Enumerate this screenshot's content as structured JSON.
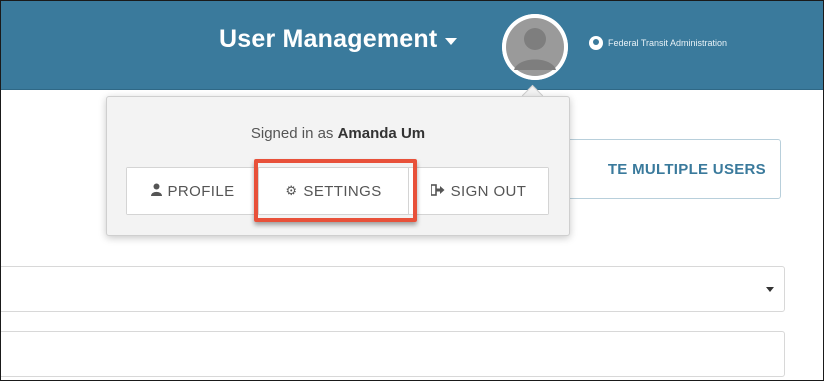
{
  "header": {
    "menu_title": "User Management",
    "agency_name": "Federal Transit Administration",
    "bar_color": "#3a7a9c",
    "avatar_icon": "user-avatar-icon"
  },
  "page": {
    "multi_users_button": "TE MULTIPLE USERS"
  },
  "dropdown": {
    "signed_in_prefix": "Signed in as",
    "user_name": "Amanda Um",
    "buttons": {
      "profile": {
        "label": "PROFILE",
        "icon": "user-icon"
      },
      "settings": {
        "label": "SETTINGS",
        "icon": "gear-icon"
      },
      "sign_out": {
        "label": "SIGN OUT",
        "icon": "sign-out-icon"
      }
    },
    "highlight_color": "#e8513a"
  }
}
